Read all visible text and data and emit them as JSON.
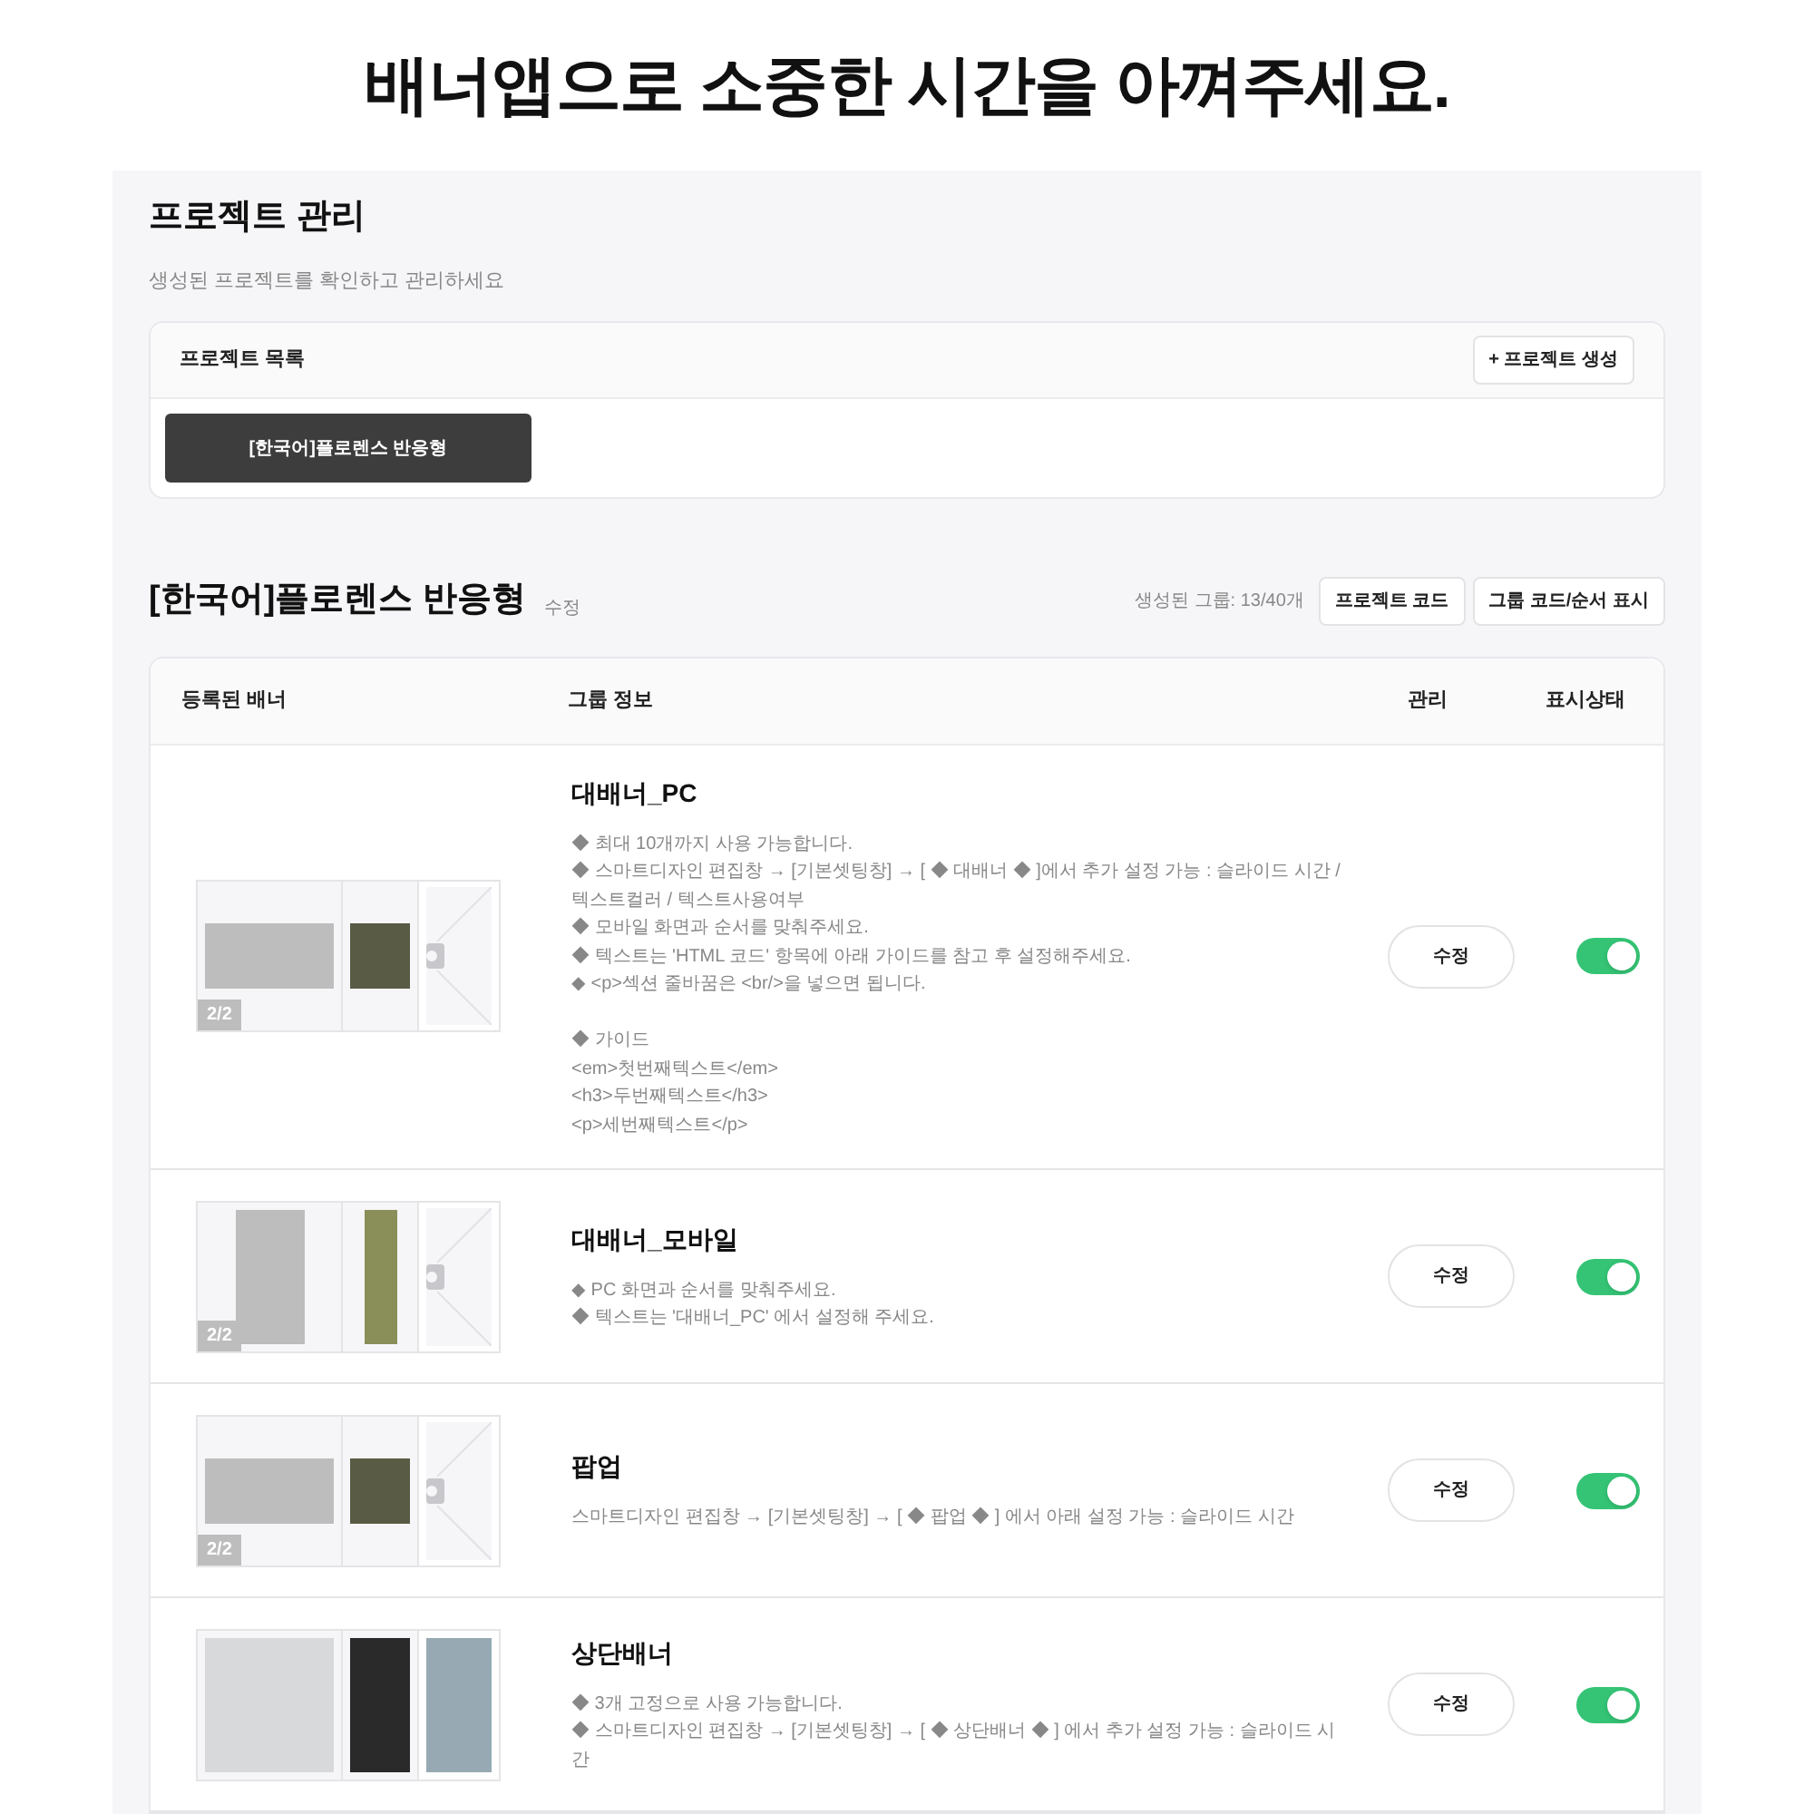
{
  "headline": "배너앱으로 소중한 시간을 아껴주세요.",
  "header": {
    "title": "프로젝트 관리",
    "subtitle": "생성된 프로젝트를 확인하고 관리하세요"
  },
  "project_list": {
    "title": "프로젝트 목록",
    "create_button": "+ 프로젝트 생성",
    "projects": [
      {
        "label": "[한국어]플로렌스 반응형",
        "selected": true
      }
    ]
  },
  "project": {
    "title": "[한국어]플로렌스 반응형",
    "edit_link": "수정",
    "group_count": "생성된 그룹: 13/40개",
    "buttons": [
      "프로젝트 코드",
      "그룹 코드/순서 표시"
    ]
  },
  "table": {
    "columns": [
      "등록된 배너",
      "그룹 정보",
      "관리",
      "표시상태"
    ],
    "rows": [
      {
        "name": "대배너_PC",
        "counter": "2/2",
        "kind": "wide",
        "paragraphs": [
          [
            "◆ 최대 10개까지 사용 가능합니다.",
            "◆ 스마트디자인 편집창 → [기본셋팅창] → [ ◆ 대배너 ◆ ]에서 추가 설정 가능 : 슬라이드 시간 / 텍스트컬러 / 텍스트사용여부",
            "◆ 모바일 화면과 순서를 맞춰주세요.",
            "◆ 텍스트는 'HTML 코드' 항목에 아래 가이드를 참고 후 설정해주세요.",
            "◆ <p>섹션 줄바꿈은 <br/>을 넣으면 됩니다."
          ],
          [
            "◆ 가이드",
            "<em>첫번째텍스트</em>",
            "<h3>두번째텍스트</h3>",
            "<p>세번째텍스트</p>"
          ]
        ],
        "edit": "수정",
        "on": true
      },
      {
        "name": "대배너_모바일",
        "counter": "2/2",
        "kind": "tall",
        "paragraphs": [
          [
            "◆ PC 화면과 순서를 맞춰주세요.",
            "◆ 텍스트는 '대배너_PC' 에서 설정해 주세요."
          ]
        ],
        "edit": "수정",
        "on": true
      },
      {
        "name": "팝업",
        "counter": "2/2",
        "kind": "wide",
        "paragraphs": [
          [
            "스마트디자인 편집창 → [기본셋팅창] → [ ◆ 팝업 ◆ ] 에서 아래 설정 가능 : 슬라이드 시간"
          ]
        ],
        "edit": "수정",
        "on": true
      },
      {
        "name": "상단배너",
        "kind": "full",
        "paragraphs": [
          [
            "◆ 3개 고정으로 사용 가능합니다.",
            "◆ 스마트디자인 편집창 → [기본셋팅창] → [ ◆ 상단배너 ◆ ] 에서 추가 설정 가능 : 슬라이드 시간"
          ]
        ],
        "edit": "수정",
        "on": true
      }
    ]
  }
}
